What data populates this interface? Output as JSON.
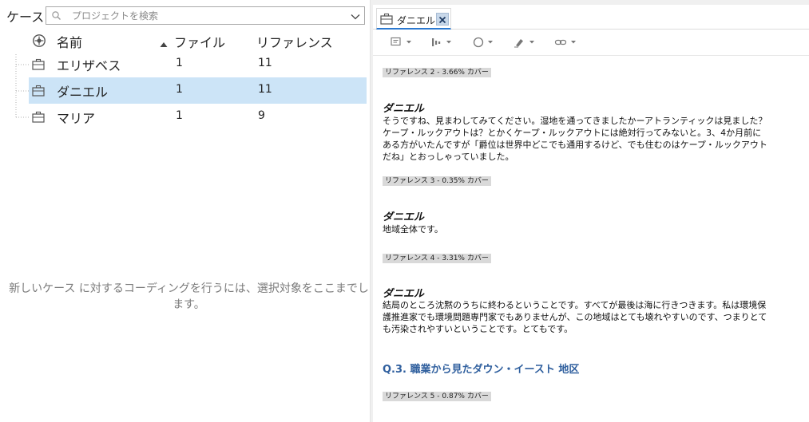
{
  "left": {
    "case_label": "ケース",
    "search": {
      "placeholder": "プロジェクトを検索",
      "value": ""
    },
    "columns": {
      "name": "名前",
      "files": "ファイル",
      "references": "リファレンス"
    },
    "rows": [
      {
        "name": "エリザベス",
        "files": "1",
        "references": "11",
        "selected": false
      },
      {
        "name": "ダニエル",
        "files": "1",
        "references": "11",
        "selected": true
      },
      {
        "name": "マリア",
        "files": "1",
        "references": "9",
        "selected": false
      }
    ],
    "empty_hint": "新しいケース に対するコーディングを行うには、選択対象をここまでします。"
  },
  "right": {
    "tab": {
      "label": "ダニエル"
    },
    "toolbar": [
      "comment-icon",
      "bar-chart-icon",
      "circle-icon",
      "highlight-icon",
      "link-icon"
    ],
    "blocks": [
      {
        "reference": "リファレンス 2 - 3.66% カバー"
      },
      {
        "speaker": "ダニエル",
        "text": "そうですね、見まわしてみてください。湿地を通ってきましたかーアトランティックは見ました？ケープ・ルックアウトは？とかくケープ・ルックアウトには絶対行ってみないと。3、4か月前にある方がいたんですが「爵位は世界中どこでも通用するけど、でも住むのはケープ・ルックアウトだね」とおっしゃっていました。"
      },
      {
        "reference": "リファレンス 3 - 0.35% カバー"
      },
      {
        "speaker": "ダニエル",
        "text": "地域全体です。"
      },
      {
        "reference": "リファレンス 4 - 3.31% カバー"
      },
      {
        "speaker": "ダニエル",
        "text": "結局のところ沈黙のうちに終わるということです。すべてが最後は海に行きつきます。私は環境保護推進家でも環境問題専門家でもありませんが、この地域はとても壊れやすいのです、つまりとても汚染されやすいということです。とてもです。"
      },
      {
        "section": "Q.3. 職業から見たダウン・イースト 地区"
      },
      {
        "reference": "リファレンス 5 - 0.87% カバー"
      }
    ]
  },
  "colors": {
    "selection": "#cce4f7",
    "reference_bg": "#d9d9d9",
    "section_heading": "#2f5f9e",
    "tab_accent": "#2b79d0"
  }
}
